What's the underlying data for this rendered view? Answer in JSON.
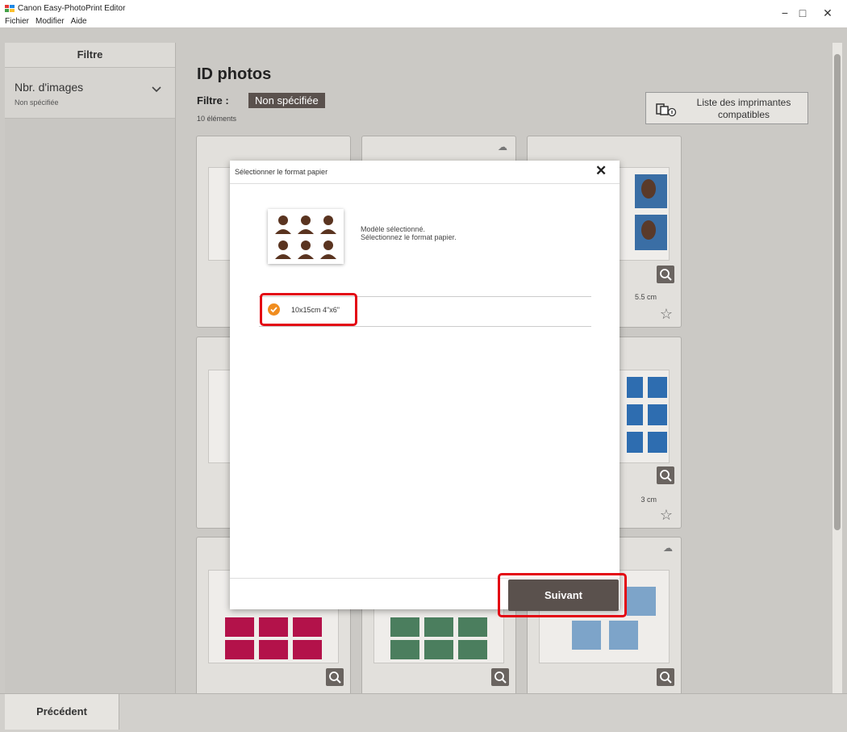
{
  "app": {
    "title": "Canon Easy-PhotoPrint Editor",
    "menu": [
      "Fichier",
      "Modifier",
      "Aide"
    ],
    "window_controls": {
      "minimize": "−",
      "maximize": "□",
      "close": "✕"
    }
  },
  "sidebar": {
    "header": "Filtre",
    "filter": {
      "label": "Nbr. d'images",
      "value": "Non spécifiée"
    }
  },
  "main": {
    "title": "ID photos",
    "filter_label": "Filtre :",
    "filter_value": "Non spécifiée",
    "count": "10 éléments",
    "compat_button": {
      "line1": "Liste des imprimantes",
      "line2": "compatibles"
    },
    "card_size_labels": [
      "5.5 cm",
      "3 cm"
    ]
  },
  "modal": {
    "title": "Sélectionner le format papier",
    "close": "✕",
    "message_line1": "Modèle sélectionné.",
    "message_line2": "Sélectionnez le format papier.",
    "option_label": "10x15cm 4\"x6\"",
    "next_button": "Suivant"
  },
  "footer": {
    "prev_button": "Précédent"
  },
  "colors": {
    "accent": "#f08c1e",
    "highlight": "#e30613",
    "button_dark": "#5a514d"
  }
}
